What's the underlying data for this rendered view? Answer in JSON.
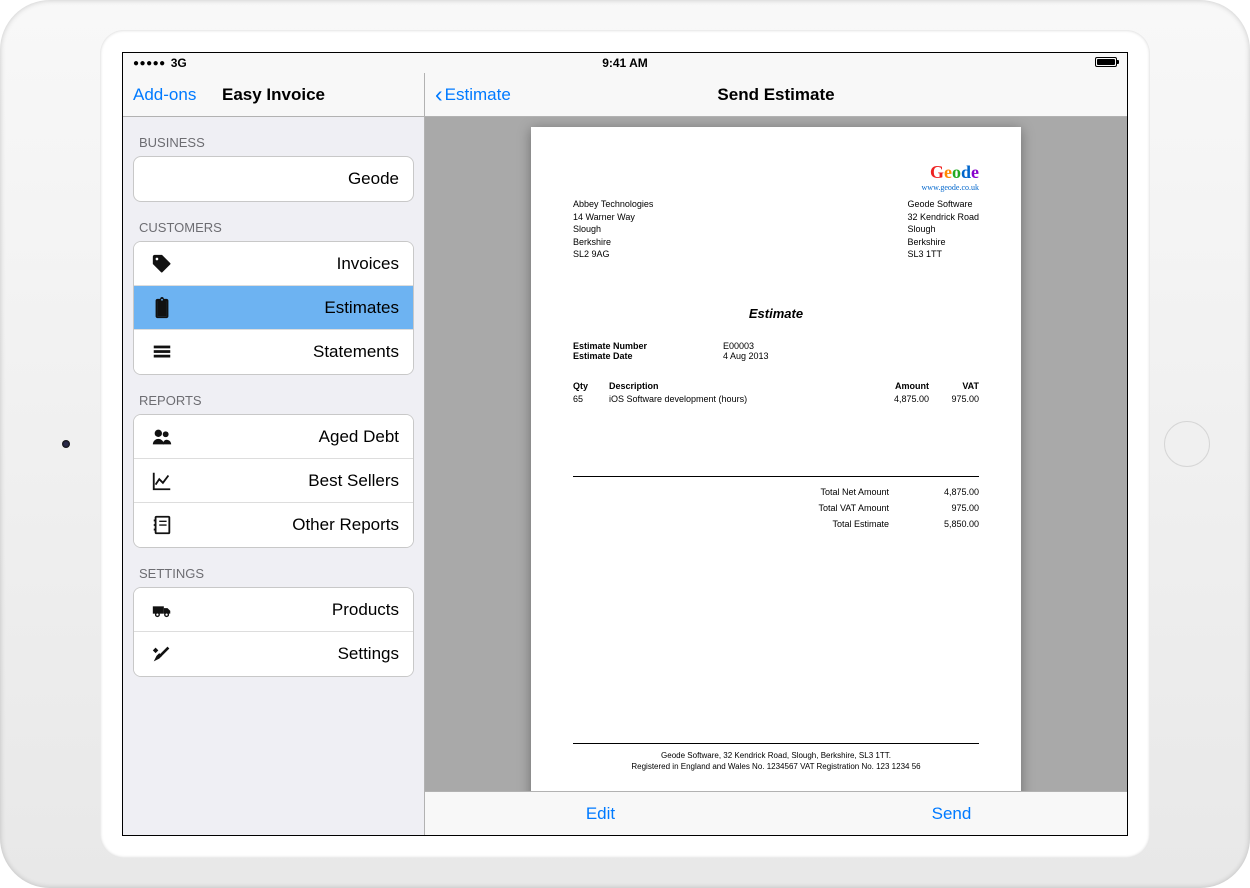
{
  "status": {
    "carrier": "3G",
    "time": "9:41 AM"
  },
  "sidebar": {
    "addons": "Add-ons",
    "title": "Easy Invoice",
    "sections": {
      "business": {
        "header": "BUSINESS",
        "value": "Geode"
      },
      "customers": {
        "header": "CUSTOMERS",
        "items": [
          {
            "label": "Invoices"
          },
          {
            "label": "Estimates"
          },
          {
            "label": "Statements"
          }
        ]
      },
      "reports": {
        "header": "REPORTS",
        "items": [
          {
            "label": "Aged Debt"
          },
          {
            "label": "Best Sellers"
          },
          {
            "label": "Other Reports"
          }
        ]
      },
      "settings": {
        "header": "SETTINGS",
        "items": [
          {
            "label": "Products"
          },
          {
            "label": "Settings"
          }
        ]
      }
    }
  },
  "main": {
    "back": "Estimate",
    "title": "Send Estimate",
    "toolbar": {
      "edit": "Edit",
      "send": "Send"
    }
  },
  "document": {
    "logo": {
      "name": "Geode",
      "url": "www.geode.co.uk"
    },
    "customer": {
      "name": "Abbey Technologies",
      "line1": "14 Warner Way",
      "line2": "Slough",
      "line3": "Berkshire",
      "postcode": "SL2 9AG"
    },
    "sender": {
      "name": "Geode Software",
      "line1": "32 Kendrick Road",
      "line2": "Slough",
      "line3": "Berkshire",
      "postcode": "SL3 1TT"
    },
    "title": "Estimate",
    "meta": {
      "number_label": "Estimate Number",
      "number": "E00003",
      "date_label": "Estimate Date",
      "date": "4 Aug 2013"
    },
    "columns": {
      "qty": "Qty",
      "desc": "Description",
      "amt": "Amount",
      "vat": "VAT"
    },
    "lines": [
      {
        "qty": "65",
        "desc": "iOS Software development (hours)",
        "amt": "4,875.00",
        "vat": "975.00"
      }
    ],
    "totals": {
      "net_label": "Total Net Amount",
      "net": "4,875.00",
      "vat_label": "Total VAT Amount",
      "vat": "975.00",
      "total_label": "Total Estimate",
      "total": "5,850.00"
    },
    "footer": {
      "line1": "Geode Software, 32 Kendrick Road, Slough, Berkshire, SL3 1TT.",
      "line2": "Registered in England and Wales No. 1234567   VAT Registration No. 123 1234 56"
    }
  }
}
